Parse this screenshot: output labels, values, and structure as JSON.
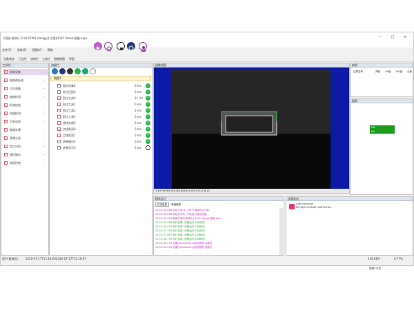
{
  "window": {
    "title": "E视觉-版本(1.0.20.0709) (dongyji) 方案(D:\\EC Demo\\测量.esp)",
    "minimize": "—",
    "maximize": "□",
    "close": "✕"
  },
  "menu": [
    "文件(F)",
    "系统(S)",
    "视图(V)",
    "帮助"
  ],
  "toolbar2": [
    "设备状态",
    "日志栏",
    "流程栏",
    "工具栏",
    "图像视图",
    "界面"
  ],
  "tools_panel": {
    "title": "工具栏",
    "items": [
      "图像采集",
      "图像预处理",
      "几何测量",
      "缺陷检测",
      "标定校准",
      "测量检测",
      "识别读码",
      "数据处理",
      "逻辑工具",
      "定位识别",
      "通信输出",
      "流程控制"
    ]
  },
  "flow_panel": {
    "title": "流程栏",
    "tab_label": "流程1",
    "items": [
      {
        "label": "相机采集0",
        "ms": "0 ms",
        "status": "ok"
      },
      {
        "label": "定位匹配0",
        "ms": "0 ms",
        "status": "ok"
      },
      {
        "label": "抓边工具0",
        "ms": "11 ms",
        "status": "ok"
      },
      {
        "label": "抓边工具1",
        "ms": "0 ms",
        "status": "ok"
      },
      {
        "label": "抓边工具2",
        "ms": "2 ms",
        "status": "ok"
      },
      {
        "label": "抓边工具3",
        "ms": "0 ms",
        "status": "ok"
      },
      {
        "label": "线线夹角0",
        "ms": "0 ms",
        "status": "ok"
      },
      {
        "label": "点线距离0",
        "ms": "0 ms",
        "status": "ok"
      },
      {
        "label": "点线距离1",
        "ms": "0 ms",
        "status": "ok"
      },
      {
        "label": "结果输出0",
        "ms": "0 ms",
        "status": "ok"
      },
      {
        "label": "结果显示0",
        "ms": "0 ms",
        "status": "none"
      }
    ]
  },
  "image_view": {
    "title": "图像视图",
    "footer": "1  X:0 Y:0 R:0 G:0 B:0 W:0 H:0 R:27 G:27 B:27"
  },
  "result_panel": {
    "title": "结果",
    "columns": [
      "结果名称",
      "判断",
      "OK值",
      "NG值",
      "公差"
    ]
  },
  "graph_panel": {
    "title": "图表",
    "values": [
      "NG",
      "NG"
    ]
  },
  "log_panel": {
    "title": "模块运行",
    "tabs": [
      "日志信息",
      "系统信息"
    ],
    "lines": [
      {
        "text": "15:13:31.666 设定方案[1], 运行方案成功(正常)",
        "color": "#cc33cc"
      },
      {
        "text": "15:13:31.666 初始化完毕, 开始运行自动测量",
        "color": "#cc33cc"
      },
      {
        "text": "15:13:31.691 新建方案文件成功 [D:\\EC Demo\\测量.esp]",
        "color": "#cc33cc"
      },
      {
        "text": "15:13:33.658 执行结果: 流程运行:26(耗时)",
        "color": "#33aa33"
      },
      {
        "text": "15:13:35.816 执行结果: 流程运行:24(耗时)",
        "color": "#33aa33"
      },
      {
        "text": "15:13:37.356 执行结果: 流程运行:23(耗时)",
        "color": "#33aa33"
      },
      {
        "text": "15:13:37.687 执行结果: 流程运行:21(耗时)",
        "color": "#33aa33"
      },
      {
        "text": "15:13:38.739 执行结果: 流程运行:23(耗时)",
        "color": "#33aa33"
      },
      {
        "text": "15:13:44.239 设置[edfvision01]相机参数 连接完",
        "color": "#cc33cc"
      },
      {
        "text": "15:13:52.124 设置[edfvision01]相机参数 连接完",
        "color": "#cc33cc"
      }
    ]
  },
  "device_panel": {
    "title": "设备状态",
    "vendor": "Gigit.Hikvision",
    "device": "MV-CE013-50GM (00E30416..."
  },
  "status": {
    "user": "用户(管理员)",
    "start": "2020-07-17T15:10:20",
    "now": "2020-07-17T15:16:07",
    "mem": "118.81M",
    "cpu": "0.77%",
    "lang": "简体 中文"
  }
}
